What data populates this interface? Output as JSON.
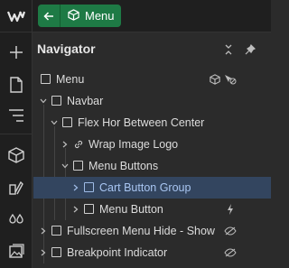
{
  "breadcrumb": {
    "component_label": "Menu"
  },
  "navigator": {
    "title": "Navigator",
    "rows": [
      {
        "label": "Menu"
      },
      {
        "label": "Navbar"
      },
      {
        "label": "Flex Hor Between Center"
      },
      {
        "label": "Wrap Image Logo"
      },
      {
        "label": "Menu Buttons"
      },
      {
        "label": "Cart Button Group"
      },
      {
        "label": "Menu Button"
      },
      {
        "label": "Fullscreen Menu Hide - Show"
      },
      {
        "label": "Breakpoint Indicator"
      }
    ]
  },
  "colors": {
    "accent_green": "#1e7a45",
    "selection": "#33455f",
    "selected_text": "#a9c6f2"
  }
}
